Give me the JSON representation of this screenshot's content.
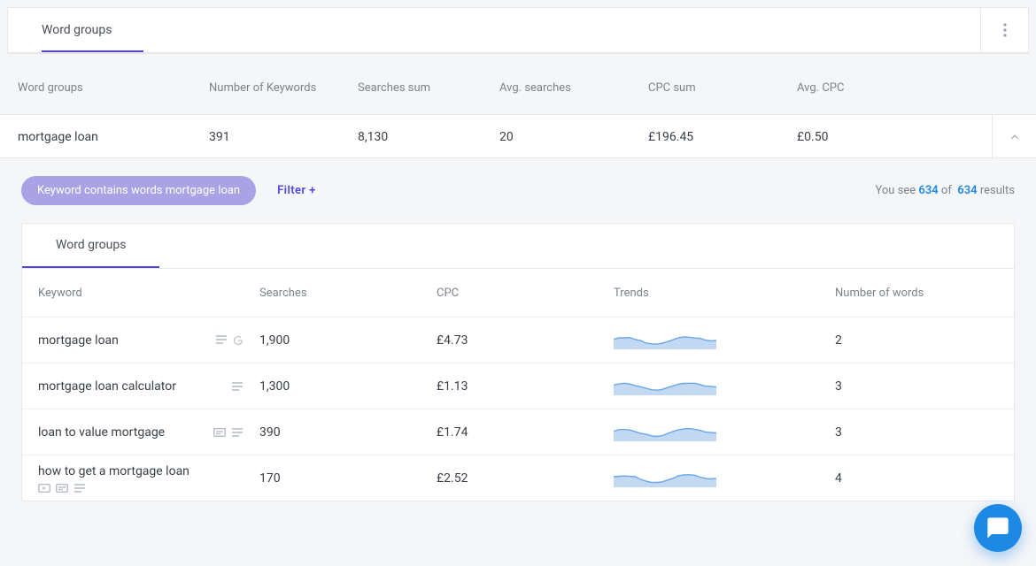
{
  "outer": {
    "tab_label": "Word groups",
    "columns": {
      "group": "Word groups",
      "keywords": "Number of Keywords",
      "searches_sum": "Searches sum",
      "avg_searches": "Avg. searches",
      "cpc_sum": "CPC sum",
      "avg_cpc": "Avg. CPC"
    },
    "row": {
      "group": "mortgage loan",
      "keywords": "391",
      "searches_sum": "8,130",
      "avg_searches": "20",
      "cpc_sum": "£196.45",
      "avg_cpc": "£0.50"
    }
  },
  "filters": {
    "chip": "Keyword contains words mortgage loan",
    "filter_label": "Filter +",
    "results_prefix": "You see",
    "results_shown": "634",
    "results_of": "of",
    "results_total": "634",
    "results_suffix": "results"
  },
  "inner": {
    "tab_label": "Word groups",
    "columns": {
      "keyword": "Keyword",
      "searches": "Searches",
      "cpc": "CPC",
      "trends": "Trends",
      "num_words": "Number of words"
    },
    "rows": [
      {
        "keyword": "mortgage loan",
        "searches": "1,900",
        "cpc": "£4.73",
        "num_words": "2",
        "icons": [
          "serp",
          "google"
        ],
        "wrap": false
      },
      {
        "keyword": "mortgage loan calculator",
        "searches": "1,300",
        "cpc": "£1.13",
        "num_words": "3",
        "icons": [
          "serp"
        ],
        "wrap": false
      },
      {
        "keyword": "loan to value mortgage",
        "searches": "390",
        "cpc": "£1.74",
        "num_words": "3",
        "icons": [
          "card",
          "serp"
        ],
        "wrap": false
      },
      {
        "keyword": "how to get a mortgage loan",
        "searches": "170",
        "cpc": "£2.52",
        "num_words": "4",
        "icons": [
          "video",
          "card",
          "serp"
        ],
        "wrap": true
      }
    ]
  }
}
